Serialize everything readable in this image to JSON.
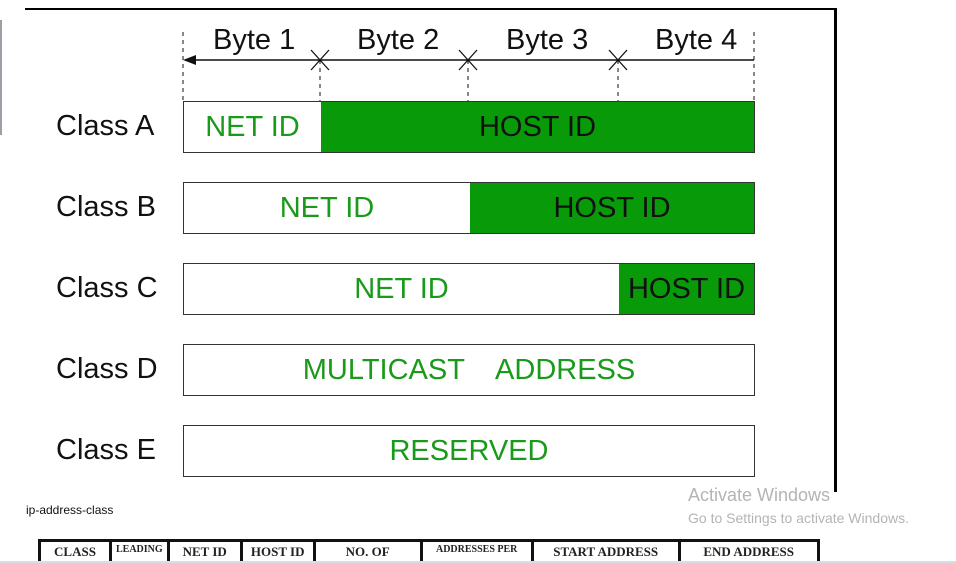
{
  "diagram": {
    "bytes": [
      "Byte 1",
      "Byte 2",
      "Byte 3",
      "Byte 4"
    ],
    "classes": [
      {
        "label": "Class A",
        "net": "NET ID",
        "host": "HOST ID"
      },
      {
        "label": "Class B",
        "net": "NET ID",
        "host": "HOST ID"
      },
      {
        "label": "Class C",
        "net": "NET ID",
        "host": "HOST ID"
      },
      {
        "label": "Class D",
        "full": "MULTICAST    ADDRESS"
      },
      {
        "label": "Class E",
        "full": "RESERVED"
      }
    ],
    "colors": {
      "host_fill": "#089a08",
      "net_text": "#1a9a1a"
    }
  },
  "caption": "ip-address-class",
  "watermark": {
    "title": "Activate Windows",
    "subtitle": "Go to Settings to activate Windows."
  },
  "table_headers": [
    "CLASS",
    "LEADING",
    "NET ID",
    "HOST ID",
    "NO. OF",
    "ADDRESSES PER",
    "START ADDRESS",
    "END ADDRESS"
  ]
}
